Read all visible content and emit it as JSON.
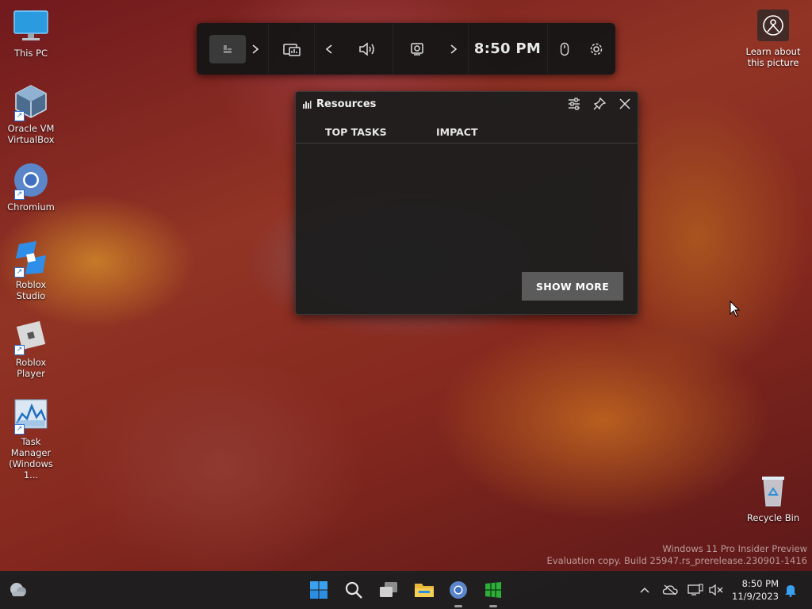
{
  "desktop": {
    "icons": [
      {
        "label": "This PC"
      },
      {
        "label": "Oracle VM VirtualBox"
      },
      {
        "label": "Chromium"
      },
      {
        "label": "Roblox Studio"
      },
      {
        "label": "Roblox Player"
      },
      {
        "label": "Task Manager (Windows 1..."
      },
      {
        "label": "Recycle Bin"
      }
    ],
    "learn_about": "Learn about this picture",
    "watermark_line1": "Windows 11 Pro Insider Preview",
    "watermark_line2": "Evaluation copy. Build 25947.rs_prerelease.230901-1416"
  },
  "gamebar": {
    "time": "8:50 PM",
    "icons": [
      "widget-menu-icon",
      "chevron-right-icon",
      "performance-icon",
      "chevron-left-icon",
      "audio-icon",
      "capture-icon",
      "chevron-right-icon",
      "mouse-icon",
      "settings-icon"
    ]
  },
  "resources_widget": {
    "title": "Resources",
    "columns": [
      "TOP TASKS",
      "IMPACT"
    ],
    "show_more": "SHOW MORE"
  },
  "taskbar": {
    "time": "8:50 PM",
    "date": "11/9/2023",
    "apps": [
      "start-icon",
      "search-icon",
      "task-view-icon",
      "file-explorer-icon",
      "chromium-icon",
      "game-app-icon"
    ]
  },
  "colors": {
    "gamebar_bg": "#161616",
    "widget_bg": "#1e1e1e",
    "button_bg": "#5b5b5b",
    "accent_blue": "#2a8fd6"
  }
}
